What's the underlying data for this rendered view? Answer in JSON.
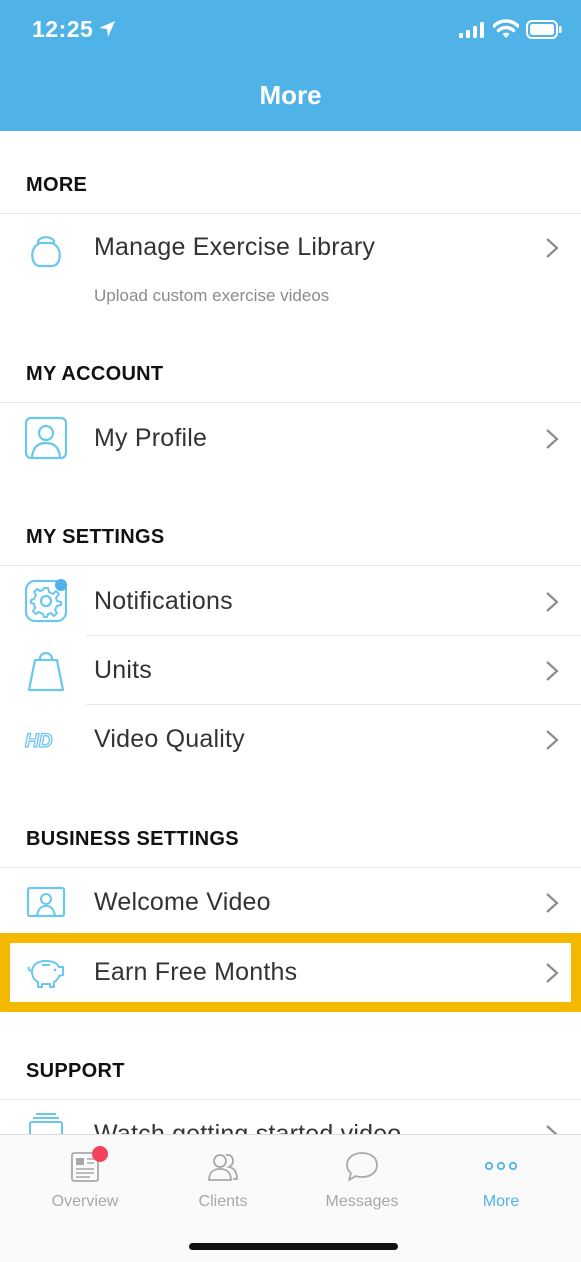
{
  "status_bar": {
    "time": "12:25"
  },
  "nav": {
    "title": "More"
  },
  "sections": {
    "more": {
      "title": "MORE",
      "items": [
        {
          "label": "Manage Exercise Library",
          "sublabel": "Upload custom exercise videos",
          "icon": "kettlebell-icon"
        }
      ]
    },
    "my_account": {
      "title": "MY ACCOUNT",
      "items": [
        {
          "label": "My Profile",
          "icon": "profile-icon"
        }
      ]
    },
    "my_settings": {
      "title": "MY SETTINGS",
      "items": [
        {
          "label": "Notifications",
          "icon": "gear-icon"
        },
        {
          "label": "Units",
          "icon": "weight-icon"
        },
        {
          "label": "Video Quality",
          "icon": "hd-icon",
          "icon_text": "HD"
        }
      ]
    },
    "business_settings": {
      "title": "BUSINESS SETTINGS",
      "items": [
        {
          "label": "Welcome Video",
          "icon": "welcome-video-icon"
        },
        {
          "label": "Earn Free Months",
          "icon": "piggy-bank-icon",
          "highlighted": true
        }
      ]
    },
    "support": {
      "title": "SUPPORT",
      "items": [
        {
          "label": "Watch getting started video",
          "icon": "video-list-icon"
        }
      ]
    }
  },
  "tabbar": {
    "tabs": [
      {
        "label": "Overview",
        "icon": "newspaper-icon",
        "badge": true
      },
      {
        "label": "Clients",
        "icon": "clients-icon"
      },
      {
        "label": "Messages",
        "icon": "chat-bubble-icon"
      },
      {
        "label": "More",
        "icon": "more-dots-icon",
        "active": true
      }
    ]
  },
  "colors": {
    "accent": "#4fb3e8",
    "highlight": "#f5b800",
    "badge": "#f2445c",
    "icon_stroke": "#6cc7ee"
  }
}
